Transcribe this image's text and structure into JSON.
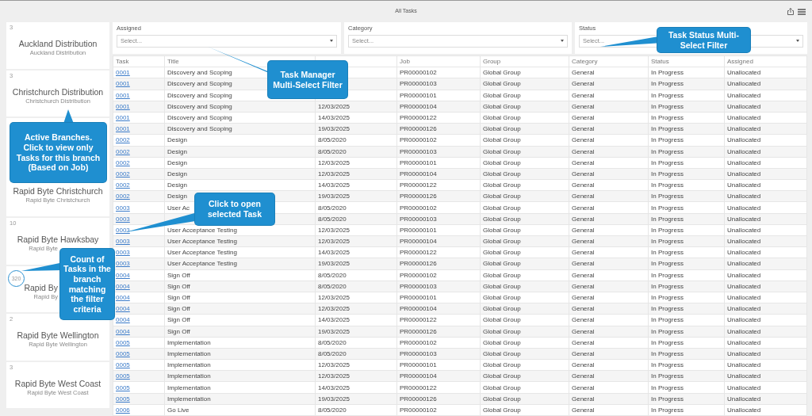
{
  "header": {
    "title": "All Tasks"
  },
  "branches": [
    {
      "count": "3",
      "name": "Auckland Distribution",
      "subtitle": "Auckland Distribution",
      "highlighted": false
    },
    {
      "count": "3",
      "name": "Christchurch Distribution",
      "subtitle": "Christchurch Distribution",
      "highlighted": false
    },
    {
      "name": "Rapid Byte Christchurch",
      "subtitle": "Rapid Byte Christchurch"
    },
    {
      "count": "10",
      "name": "Rapid Byte Hawksbay",
      "subtitle": "Rapid Byte",
      "highlighted": false
    },
    {
      "count": "320",
      "name": "Rapid By",
      "subtitle": "Rapid By",
      "highlighted": true
    },
    {
      "count": "2",
      "name": "Rapid Byte Wellington",
      "subtitle": "Rapid Byte Wellington",
      "highlighted": false
    },
    {
      "count": "3",
      "name": "Rapid Byte West Coast",
      "subtitle": "Rapid Byte West Coast",
      "highlighted": false
    }
  ],
  "filters": [
    {
      "label": "Assigned",
      "placeholder": "Select..."
    },
    {
      "label": "Category",
      "placeholder": "Select..."
    },
    {
      "label": "Status",
      "placeholder": "Select..."
    }
  ],
  "table": {
    "columns": [
      "Task",
      "Title",
      null,
      "Job",
      "Group",
      "Category",
      "Status",
      "Assigned"
    ],
    "rows": [
      [
        "0001",
        "Discovery and Scoping",
        null,
        "PR00000102",
        "Global Group",
        "General",
        "In Progress",
        "Unallocated"
      ],
      [
        "0001",
        "Discovery and Scoping",
        null,
        "PR00000103",
        "Global Group",
        "General",
        "In Progress",
        "Unallocated"
      ],
      [
        "0001",
        "Discovery and Scoping",
        null,
        "PR00000101",
        "Global Group",
        "General",
        "In Progress",
        "Unallocated"
      ],
      [
        "0001",
        "Discovery and Scoping",
        "12/03/2025",
        "PR00000104",
        "Global Group",
        "General",
        "In Progress",
        "Unallocated"
      ],
      [
        "0001",
        "Discovery and Scoping",
        "14/03/2025",
        "PR00000122",
        "Global Group",
        "General",
        "In Progress",
        "Unallocated"
      ],
      [
        "0001",
        "Discovery and Scoping",
        "19/03/2025",
        "PR00000126",
        "Global Group",
        "General",
        "In Progress",
        "Unallocated"
      ],
      [
        "0002",
        "Design",
        "8/05/2020",
        "PR00000102",
        "Global Group",
        "General",
        "In Progress",
        "Unallocated"
      ],
      [
        "0002",
        "Design",
        "8/05/2020",
        "PR00000103",
        "Global Group",
        "General",
        "In Progress",
        "Unallocated"
      ],
      [
        "0002",
        "Design",
        "12/03/2025",
        "PR00000101",
        "Global Group",
        "General",
        "In Progress",
        "Unallocated"
      ],
      [
        "0002",
        "Design",
        "12/03/2025",
        "PR00000104",
        "Global Group",
        "General",
        "In Progress",
        "Unallocated"
      ],
      [
        "0002",
        "Design",
        "14/03/2025",
        "PR00000122",
        "Global Group",
        "General",
        "In Progress",
        "Unallocated"
      ],
      [
        "0002",
        "Design",
        "19/03/2025",
        "PR00000126",
        "Global Group",
        "General",
        "In Progress",
        "Unallocated"
      ],
      [
        "0003",
        "User Ac",
        "8/05/2020",
        "PR00000102",
        "Global Group",
        "General",
        "In Progress",
        "Unallocated"
      ],
      [
        "0003",
        null,
        "8/05/2020",
        "PR00000103",
        "Global Group",
        "General",
        "In Progress",
        "Unallocated"
      ],
      [
        "0003",
        "User Acceptance Testing",
        "12/03/2025",
        "PR00000101",
        "Global Group",
        "General",
        "In Progress",
        "Unallocated"
      ],
      [
        "0003",
        "User Acceptance Testing",
        "12/03/2025",
        "PR00000104",
        "Global Group",
        "General",
        "In Progress",
        "Unallocated"
      ],
      [
        "0003",
        "User Acceptance Testing",
        "14/03/2025",
        "PR00000122",
        "Global Group",
        "General",
        "In Progress",
        "Unallocated"
      ],
      [
        "0003",
        "User Acceptance Testing",
        "19/03/2025",
        "PR00000126",
        "Global Group",
        "General",
        "In Progress",
        "Unallocated"
      ],
      [
        "0004",
        "Sign Off",
        "8/05/2020",
        "PR00000102",
        "Global Group",
        "General",
        "In Progress",
        "Unallocated"
      ],
      [
        "0004",
        "Sign Off",
        "8/05/2020",
        "PR00000103",
        "Global Group",
        "General",
        "In Progress",
        "Unallocated"
      ],
      [
        "0004",
        "Sign Off",
        "12/03/2025",
        "PR00000101",
        "Global Group",
        "General",
        "In Progress",
        "Unallocated"
      ],
      [
        "0004",
        "Sign Off",
        "12/03/2025",
        "PR00000104",
        "Global Group",
        "General",
        "In Progress",
        "Unallocated"
      ],
      [
        "0004",
        "Sign Off",
        "14/03/2025",
        "PR00000122",
        "Global Group",
        "General",
        "In Progress",
        "Unallocated"
      ],
      [
        "0004",
        "Sign Off",
        "19/03/2025",
        "PR00000126",
        "Global Group",
        "General",
        "In Progress",
        "Unallocated"
      ],
      [
        "0005",
        "Implementation",
        "8/05/2020",
        "PR00000102",
        "Global Group",
        "General",
        "In Progress",
        "Unallocated"
      ],
      [
        "0005",
        "Implementation",
        "8/05/2020",
        "PR00000103",
        "Global Group",
        "General",
        "In Progress",
        "Unallocated"
      ],
      [
        "0005",
        "Implementation",
        "12/03/2025",
        "PR00000101",
        "Global Group",
        "General",
        "In Progress",
        "Unallocated"
      ],
      [
        "0005",
        "Implementation",
        "12/03/2025",
        "PR00000104",
        "Global Group",
        "General",
        "In Progress",
        "Unallocated"
      ],
      [
        "0005",
        "Implementation",
        "14/03/2025",
        "PR00000122",
        "Global Group",
        "General",
        "In Progress",
        "Unallocated"
      ],
      [
        "0005",
        "Implementation",
        "19/03/2025",
        "PR00000126",
        "Global Group",
        "General",
        "In Progress",
        "Unallocated"
      ],
      [
        "0006",
        "Go Live",
        "8/05/2020",
        "PR00000102",
        "Global Group",
        "General",
        "In Progress",
        "Unallocated"
      ]
    ]
  },
  "callouts": [
    {
      "text": "Task Manager Multi-Select Filter"
    },
    {
      "text": "Task Status Multi-Select Filter"
    },
    {
      "text": "Active Branches. Click to view only Tasks for this branch (Based on Job)"
    },
    {
      "text": "Click to open selected Task"
    },
    {
      "text": "Count of Tasks in the branch matching the filter criteria"
    }
  ]
}
